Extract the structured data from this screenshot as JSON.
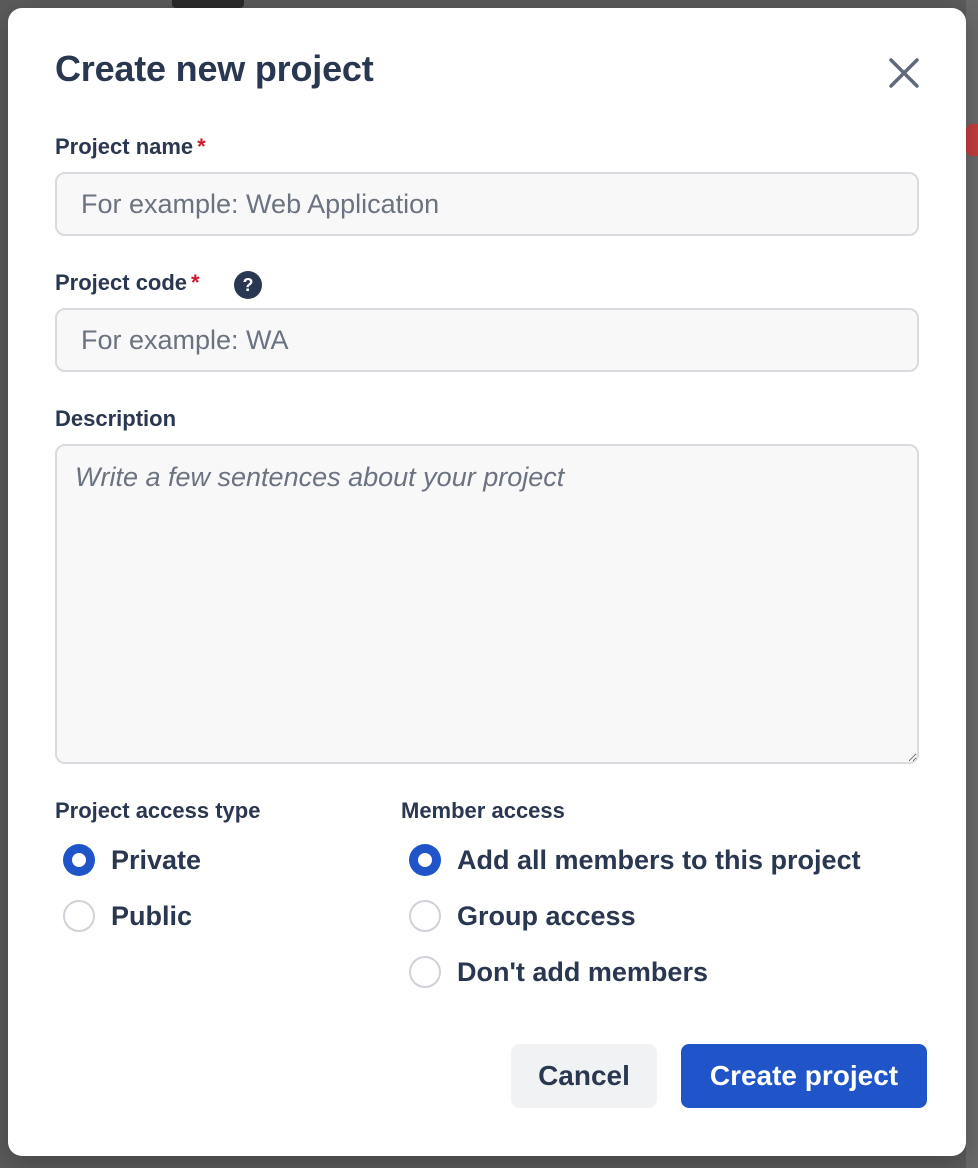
{
  "modal": {
    "title": "Create new project",
    "close_icon": "close-icon"
  },
  "fields": {
    "project_name": {
      "label": "Project name",
      "required_mark": "*",
      "value": "",
      "placeholder": "For example: Web Application"
    },
    "project_code": {
      "label": "Project code",
      "required_mark": "*",
      "help_icon": "question-mark-icon",
      "help_glyph": "?",
      "value": "",
      "placeholder": "For example: WA"
    },
    "description": {
      "label": "Description",
      "value": "",
      "placeholder": "Write a few sentences about your project"
    }
  },
  "access_type": {
    "label": "Project access type",
    "selected": "Private",
    "options": [
      {
        "label": "Private",
        "checked": true
      },
      {
        "label": "Public",
        "checked": false
      }
    ]
  },
  "member_access": {
    "label": "Member access",
    "selected": "Add all members to this project",
    "options": [
      {
        "label": "Add all members to this project",
        "checked": true
      },
      {
        "label": "Group access",
        "checked": false
      },
      {
        "label": "Don't add members",
        "checked": false
      }
    ]
  },
  "buttons": {
    "cancel": "Cancel",
    "create": "Create project"
  },
  "colors": {
    "primary": "#1f55c8",
    "text": "#2a3750",
    "required": "#cf1a2e",
    "input_bg": "#f8f8f9",
    "input_border": "#d8dae0"
  }
}
